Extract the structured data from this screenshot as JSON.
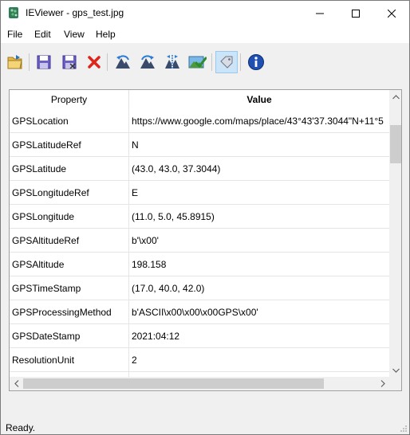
{
  "window": {
    "title": "IEViewer - gps_test.jpg"
  },
  "menu": {
    "items": [
      "File",
      "Edit",
      "View",
      "Help"
    ]
  },
  "toolbar": {
    "buttons": [
      {
        "icon": "open-folder-icon"
      },
      {
        "icon": "save-icon"
      },
      {
        "icon": "save-as-icon"
      },
      {
        "icon": "delete-icon"
      },
      {
        "icon": "rotate-left-icon"
      },
      {
        "icon": "rotate-right-icon"
      },
      {
        "icon": "flip-icon"
      },
      {
        "icon": "apply-image-icon"
      },
      {
        "icon": "tag-icon"
      },
      {
        "icon": "info-icon"
      }
    ]
  },
  "grid": {
    "columns": [
      "Property",
      "Value"
    ],
    "rows": [
      [
        "GPSLocation",
        "https://www.google.com/maps/place/43°43'37.3044\"N+11°5"
      ],
      [
        "GPSLatitudeRef",
        "N"
      ],
      [
        "GPSLatitude",
        "(43.0, 43.0, 37.3044)"
      ],
      [
        "GPSLongitudeRef",
        "E"
      ],
      [
        "GPSLongitude",
        "(11.0, 5.0, 45.8915)"
      ],
      [
        "GPSAltitudeRef",
        "b'\\x00'"
      ],
      [
        "GPSAltitude",
        "198.158"
      ],
      [
        "GPSTimeStamp",
        "(17.0, 40.0, 42.0)"
      ],
      [
        "GPSProcessingMethod",
        "b'ASCII\\x00\\x00\\x00GPS\\x00'"
      ],
      [
        "GPSDateStamp",
        "2021:04:12"
      ],
      [
        "ResolutionUnit",
        "2"
      ],
      [
        "",
        ""
      ]
    ]
  },
  "status": {
    "text": "Ready."
  }
}
